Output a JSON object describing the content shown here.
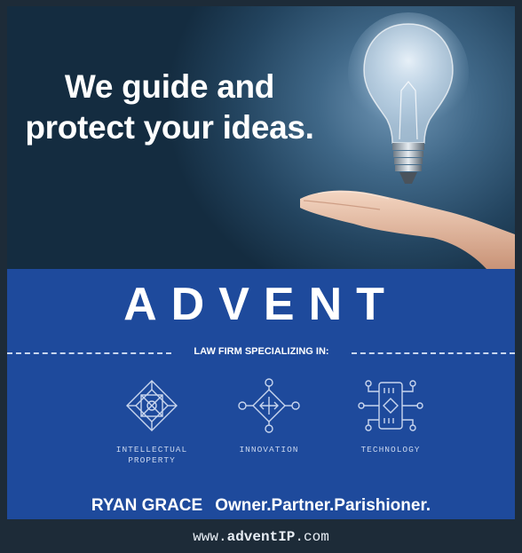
{
  "hero": {
    "headline_line1": "We guide and",
    "headline_line2": "protect your ideas."
  },
  "brand": {
    "name": "ADVENT",
    "tagline": "LAW FIRM SPECIALIZING IN:"
  },
  "services": [
    {
      "label_line1": "INTELLECTUAL",
      "label_line2": "PROPERTY",
      "icon": "intellectual-property-icon"
    },
    {
      "label_line1": "INNOVATION",
      "label_line2": "",
      "icon": "innovation-icon"
    },
    {
      "label_line1": "TECHNOLOGY",
      "label_line2": "",
      "icon": "technology-icon"
    }
  ],
  "contact": {
    "name": "RYAN GRACE",
    "role": "Owner.Partner.Parishioner."
  },
  "footer": {
    "url_prefix": "www.",
    "url_domain": "adventIP",
    "url_suffix": ".com"
  },
  "colors": {
    "band_blue": "#1e4a9c",
    "dark_navy": "#1d2b38",
    "hero_blue": "#3f6787"
  }
}
